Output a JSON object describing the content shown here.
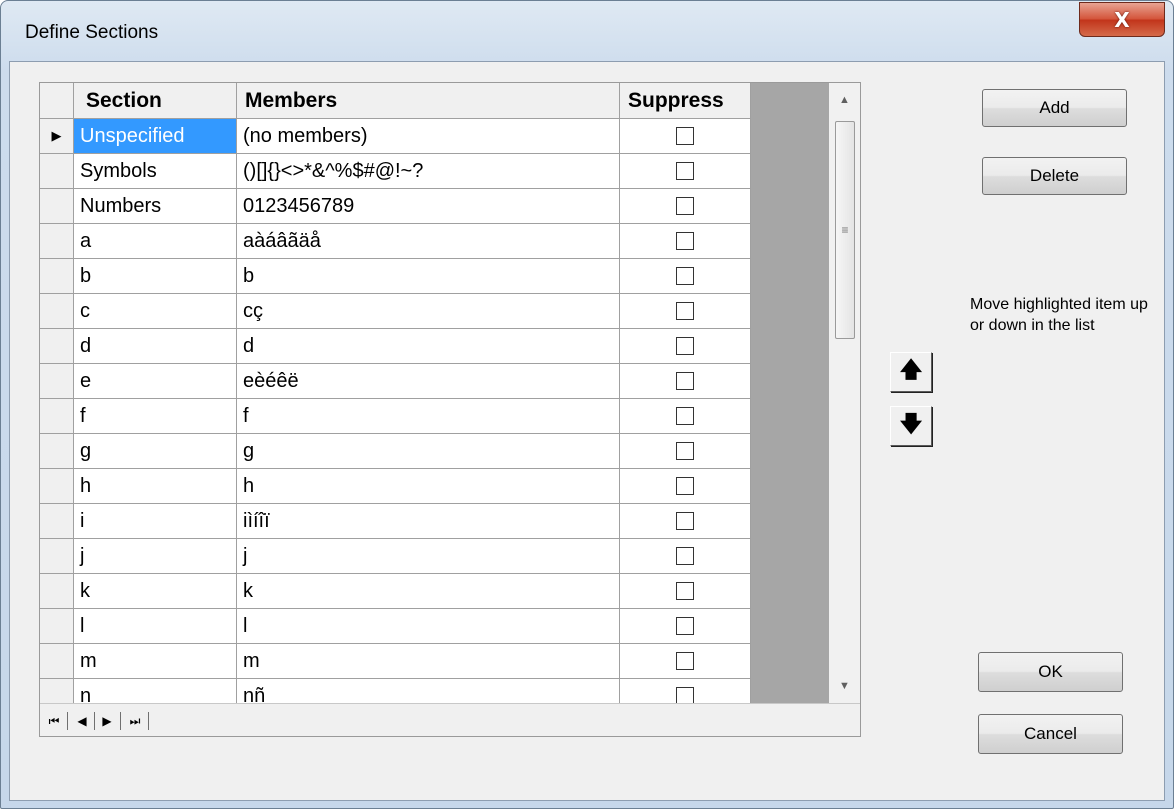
{
  "window": {
    "title": "Define Sections",
    "close_glyph": "X"
  },
  "grid": {
    "columns": [
      "Section",
      "Members",
      "Suppress"
    ],
    "current_row_indicator": "▶",
    "rows": [
      {
        "section": "Unspecified",
        "members": "(no members)",
        "suppress": false,
        "selected": true
      },
      {
        "section": "Symbols",
        "members": "()[]{}<>*&^%$#@!~?",
        "suppress": false
      },
      {
        "section": "Numbers",
        "members": "0123456789",
        "suppress": false
      },
      {
        "section": "a",
        "members": "aàáâãäå",
        "suppress": false
      },
      {
        "section": "b",
        "members": "b",
        "suppress": false
      },
      {
        "section": "c",
        "members": "cç",
        "suppress": false
      },
      {
        "section": "d",
        "members": "d",
        "suppress": false
      },
      {
        "section": "e",
        "members": "eèéêë",
        "suppress": false
      },
      {
        "section": "f",
        "members": "f",
        "suppress": false
      },
      {
        "section": "g",
        "members": "g",
        "suppress": false
      },
      {
        "section": "h",
        "members": "h",
        "suppress": false
      },
      {
        "section": "i",
        "members": "iìíîï",
        "suppress": false
      },
      {
        "section": "j",
        "members": "j",
        "suppress": false
      },
      {
        "section": "k",
        "members": "k",
        "suppress": false
      },
      {
        "section": "l",
        "members": "l",
        "suppress": false
      },
      {
        "section": "m",
        "members": "m",
        "suppress": false
      },
      {
        "section": "n",
        "members": "nñ",
        "suppress": false
      }
    ],
    "scroll": {
      "up": "▲",
      "down": "▼",
      "grip": "≡"
    },
    "navigator": {
      "first": "⏮",
      "prev": "◀",
      "next": "▶",
      "last": "⏭"
    }
  },
  "buttons": {
    "add": "Add",
    "delete": "Delete",
    "ok": "OK",
    "cancel": "Cancel"
  },
  "move": {
    "up_glyph": "🡅",
    "down_glyph": "🡇",
    "hint": "Move highlighted item up or down in the list"
  },
  "colors": {
    "selection": "#3399ff",
    "close_button": "#c2351b",
    "empty_area": "#a6a6a6"
  }
}
